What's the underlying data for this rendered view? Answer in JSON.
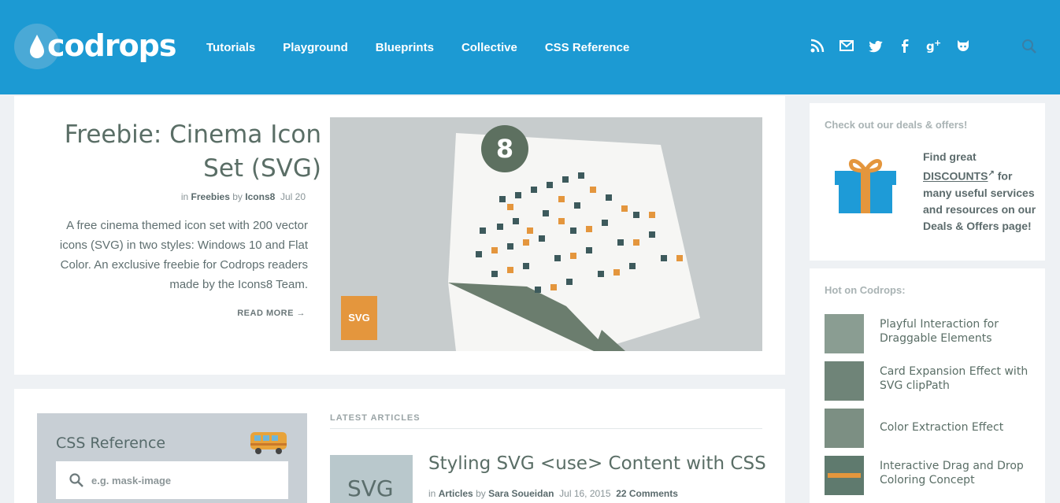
{
  "brand": {
    "name": "codrops"
  },
  "nav": [
    "Tutorials",
    "Playground",
    "Blueprints",
    "Collective",
    "CSS Reference"
  ],
  "social_icons": [
    "rss-icon",
    "mail-icon",
    "twitter-icon",
    "facebook-icon",
    "google-plus-icon",
    "github-icon"
  ],
  "feature": {
    "title_line1": "Freebie: Cinema Icon",
    "title_line2": "Set (SVG)",
    "meta_in": "in",
    "category": "Freebies",
    "meta_by": "by",
    "author": "Icons8",
    "date": "Jul 20",
    "description": "A free cinema themed icon set with 200 vector icons (SVG) in two styles: Windows 10 and Flat Color. An exclusive freebie for Codrops readers made by the Icons8 Team.",
    "read_more": "READ MORE →",
    "badge": "SVG"
  },
  "deals": {
    "heading": "Check out our deals & offers!",
    "text_before": "Find great",
    "link": "DISCOUNTS",
    "text_after": "for many useful services and resources on our Deals & Offers page!"
  },
  "hot": {
    "heading": "Hot on Codrops:",
    "items": [
      "Playful Interaction for Draggable Elements",
      "Card Expansion Effect with SVG clipPath",
      "Color Extraction Effect",
      "Interactive Drag and Drop Coloring Concept"
    ]
  },
  "css_reference": {
    "title": "CSS Reference",
    "placeholder": "e.g. mask-image"
  },
  "latest": {
    "label": "LATEST ARTICLES",
    "article": {
      "title": "Styling SVG <use> Content with CSS",
      "meta_in": "in",
      "category": "Articles",
      "meta_by": "by",
      "author": "Sara Soueidan",
      "date": "Jul 16, 2015",
      "comments": "22 Comments",
      "thumb_text": "SVG"
    }
  },
  "colors": {
    "header": "#1c9ad3",
    "accent_orange": "#e4963d",
    "gift_blue": "#1e9bd7"
  }
}
